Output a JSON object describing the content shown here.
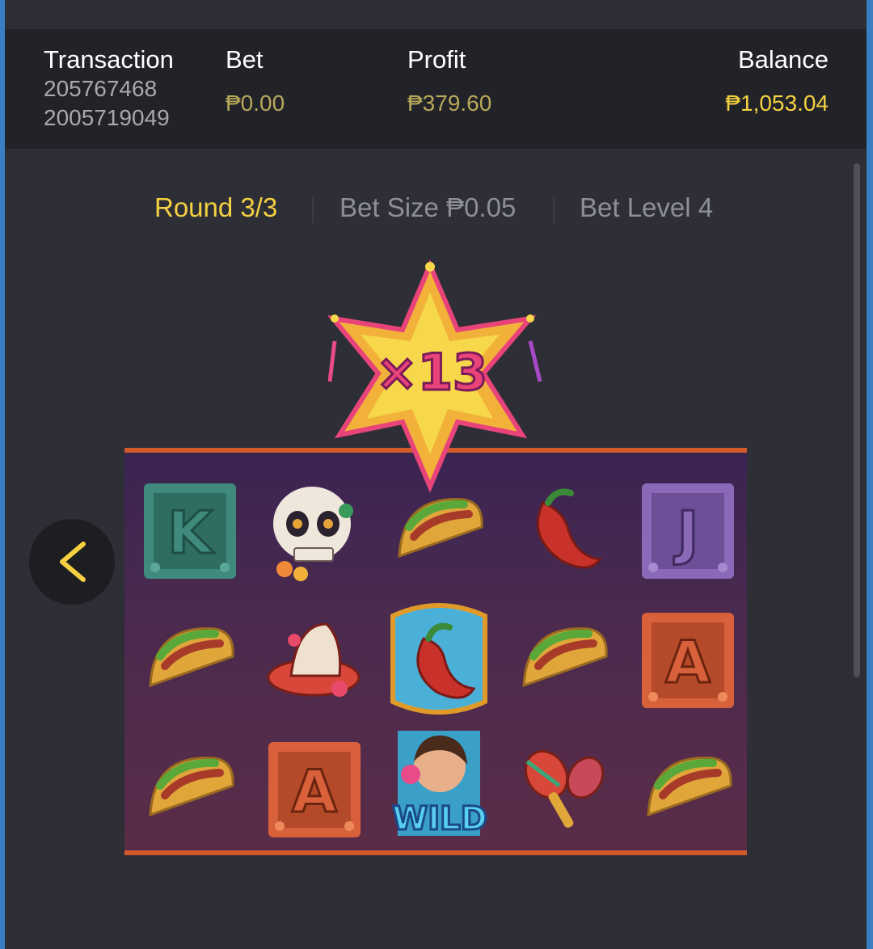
{
  "header": {
    "transaction_label": "Transaction",
    "transaction_id_line1": "205767468",
    "transaction_id_line2": "2005719049",
    "bet_label": "Bet",
    "bet_value": "₱0.00",
    "profit_label": "Profit",
    "profit_value": "₱379.60",
    "balance_label": "Balance",
    "balance_value": "₱1,053.04"
  },
  "round_info": {
    "round": "Round 3/3",
    "bet_size": "Bet Size ₱0.05",
    "bet_level": "Bet Level 4"
  },
  "multiplier": "×13",
  "reels": {
    "rows": [
      [
        "K",
        "skull",
        "taco",
        "chili",
        "J"
      ],
      [
        "taco",
        "sombrero",
        "chili-framed",
        "taco",
        "A"
      ],
      [
        "taco",
        "A",
        "WILD",
        "maracas",
        "taco"
      ]
    ]
  },
  "icons": {
    "prev": "chevron-left-icon"
  },
  "colors": {
    "accent_yellow": "#f5d142",
    "muted_gold": "#b8a85a",
    "header_bg": "#222328",
    "panel_bg": "#2d2e36"
  }
}
